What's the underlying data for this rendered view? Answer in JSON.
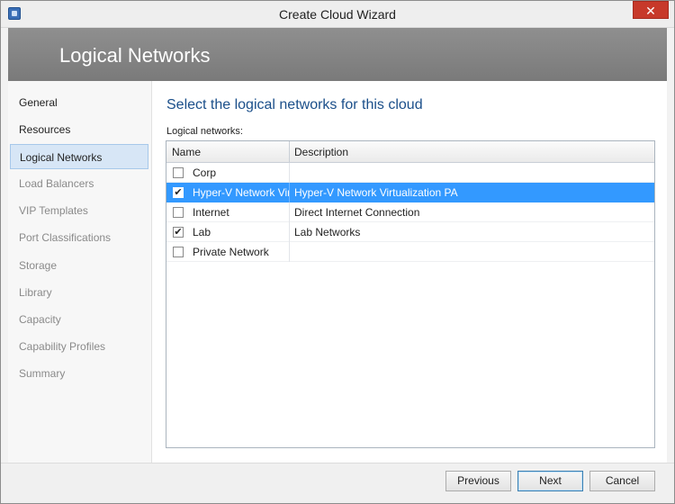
{
  "window": {
    "title": "Create Cloud Wizard",
    "close_label": "✕"
  },
  "banner": {
    "title": "Logical Networks"
  },
  "nav": {
    "items": [
      {
        "label": "General",
        "state": "normal"
      },
      {
        "label": "Resources",
        "state": "normal"
      },
      {
        "label": "Logical Networks",
        "state": "selected"
      },
      {
        "label": "Load Balancers",
        "state": "disabled"
      },
      {
        "label": "VIP Templates",
        "state": "disabled"
      },
      {
        "label": "Port Classifications",
        "state": "disabled"
      },
      {
        "label": "Storage",
        "state": "disabled"
      },
      {
        "label": "Library",
        "state": "disabled"
      },
      {
        "label": "Capacity",
        "state": "disabled"
      },
      {
        "label": "Capability Profiles",
        "state": "disabled"
      },
      {
        "label": "Summary",
        "state": "disabled"
      }
    ]
  },
  "main": {
    "heading": "Select the logical networks for this cloud",
    "list_label": "Logical networks:",
    "columns": {
      "name": "Name",
      "description": "Description"
    },
    "rows": [
      {
        "name": "Corp",
        "description": "",
        "checked": false,
        "selected": false
      },
      {
        "name": "Hyper-V Network Virtualization PA",
        "description": "Hyper-V Network Virtualization PA",
        "checked": true,
        "selected": true
      },
      {
        "name": "Internet",
        "description": "Direct Internet Connection",
        "checked": false,
        "selected": false
      },
      {
        "name": "Lab",
        "description": "Lab Networks",
        "checked": true,
        "selected": false
      },
      {
        "name": "Private Network",
        "description": "",
        "checked": false,
        "selected": false
      }
    ]
  },
  "footer": {
    "previous_label": "Previous",
    "next_label": "Next",
    "cancel_label": "Cancel"
  },
  "colors": {
    "accent": "#3399ff",
    "heading": "#1b4f8a",
    "close": "#c7392a"
  },
  "icons": {
    "app": "wizard-app-icon",
    "check": "✔"
  }
}
